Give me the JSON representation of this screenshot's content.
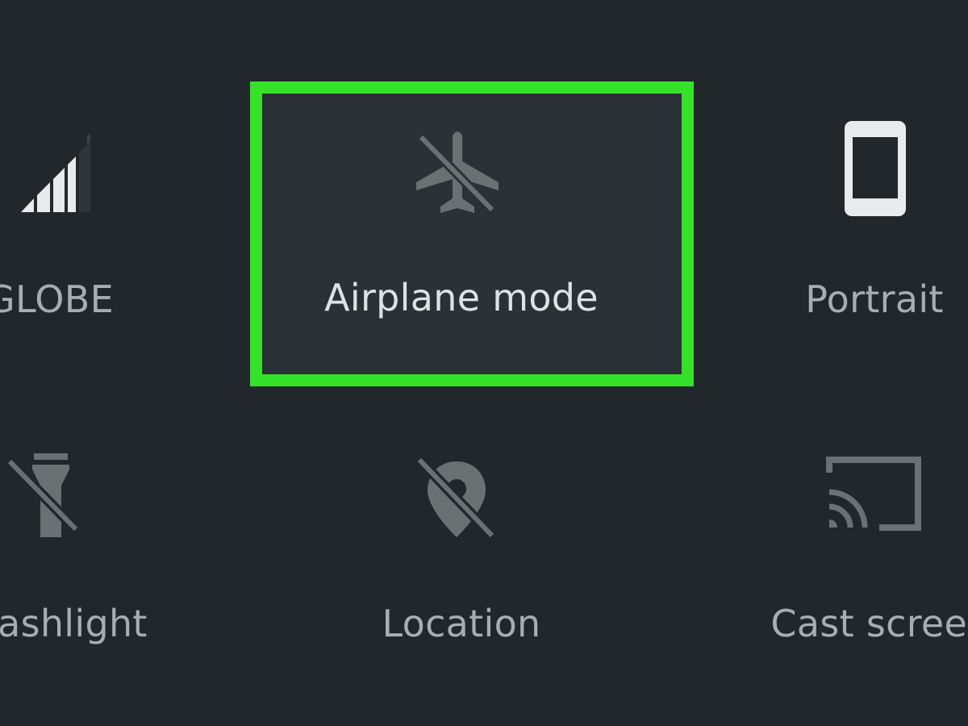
{
  "quick_settings": {
    "tiles": [
      {
        "label": "GLOBE",
        "icon": "cellular-signal-icon",
        "state": "on"
      },
      {
        "label": "Airplane mode",
        "icon": "airplane-off-icon",
        "state": "off",
        "highlighted": true
      },
      {
        "label": "Portrait",
        "icon": "phone-portrait-icon",
        "state": "on"
      },
      {
        "label": "Flashlight",
        "icon": "flashlight-off-icon",
        "state": "off"
      },
      {
        "label": "Location",
        "icon": "location-off-icon",
        "state": "off"
      },
      {
        "label": "Cast screen",
        "icon": "cast-icon",
        "state": "off"
      }
    ]
  },
  "colors": {
    "background": "#22272b",
    "highlight_border": "#35e22a",
    "icon_active": "#e8eaeb",
    "icon_inactive": "#6b7073",
    "label": "#a9adb0"
  }
}
